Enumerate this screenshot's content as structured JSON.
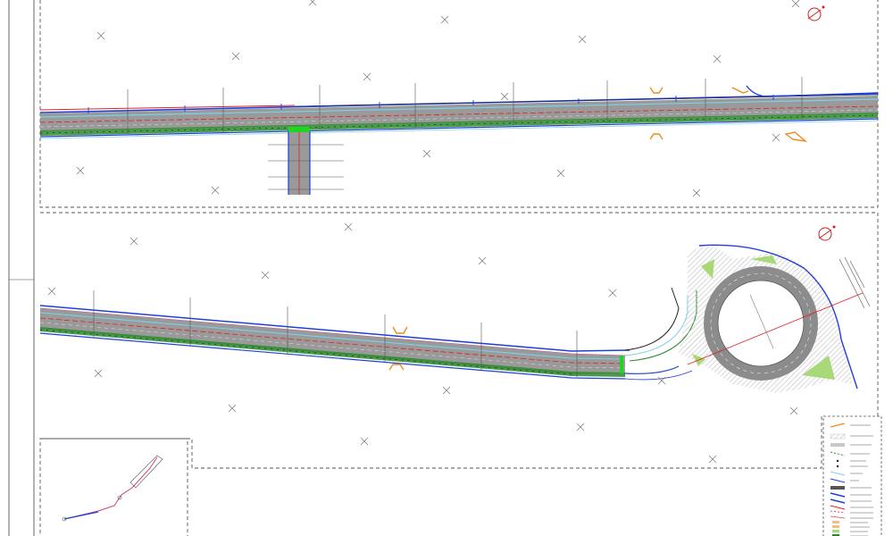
{
  "drawing": {
    "description_free": true,
    "north_symbol": "north-arrow-icon",
    "survey_marker_symbol": "cross-marker-icon"
  },
  "colors": {
    "road_surface": "#8c8c8c",
    "road_edge_blue": "#1f3fd6",
    "centerline_red": "#e02020",
    "median_green": "#2a8a2a",
    "bright_green": "#22d422",
    "light_cyan": "#7fd0e8",
    "pink_line": "#d04080",
    "orange_marking": "#f08a1a",
    "gray_hatch": "#c8c8c8",
    "island_green": "#a8d878",
    "frame_dash": "#555555"
  },
  "legend": {
    "title": "",
    "items": [
      {
        "symbol": "orange-line",
        "label": ""
      },
      {
        "symbol": "gray-hatch",
        "label": ""
      },
      {
        "symbol": "gray-fill",
        "label": ""
      },
      {
        "symbol": "green-dash",
        "label": ""
      },
      {
        "symbol": "dot",
        "label": ""
      },
      {
        "symbol": "dot",
        "label": ""
      },
      {
        "symbol": "cyan-line",
        "label": ""
      },
      {
        "symbol": "blue-line",
        "label": ""
      },
      {
        "symbol": "dark-fill",
        "label": ""
      },
      {
        "symbol": "blue-line",
        "label": ""
      },
      {
        "symbol": "blue-line",
        "label": ""
      },
      {
        "symbol": "red-blue",
        "label": ""
      },
      {
        "symbol": "red-dash",
        "label": ""
      },
      {
        "symbol": "pink-line",
        "label": ""
      },
      {
        "symbol": "orange-fill",
        "label": ""
      },
      {
        "symbol": "orange-fill",
        "label": ""
      },
      {
        "symbol": "green-fill",
        "label": ""
      },
      {
        "symbol": "green-fill",
        "label": ""
      }
    ]
  }
}
